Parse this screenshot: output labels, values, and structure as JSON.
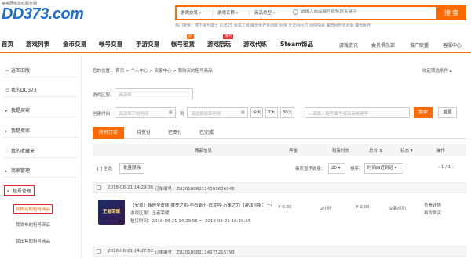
{
  "header": {
    "slogan": "嘟嘟网络游戏服务网",
    "logo": "DD373.com",
    "search": {
      "game_type": "游戏交易",
      "game_name": "游戏名称",
      "product_type": "商品类型",
      "placeholder": "请输入商品编号或标题关键字",
      "button": "搜 索"
    },
    "hot_words": "热门搜索：地下城与勇士  征途2S  浪漫之城  魔兽世界怀旧服  剑侠  天涯明月刀  剑侠情缘  魔兽世界怀旧服  魔兽世界"
  },
  "nav": {
    "items": [
      "首页",
      "游戏列表",
      "金币交易",
      "帐号交易",
      "手游交易",
      "帐号租赁",
      "游戏陪玩",
      "游戏代练",
      "Steam饰品"
    ],
    "badges": {
      "rent": "热",
      "companion": "限时"
    },
    "right": [
      "游戏资讯",
      "会员俱乐部",
      "推广联盟",
      "客服中心"
    ]
  },
  "sidebar": {
    "back": "返回旧版",
    "my_dd373": "我的DD373",
    "buyer": "我是买家",
    "seller": "我是卖家",
    "favorites": "我的收藏夹",
    "merchant": "商家管理",
    "rent_manage": "租号管理",
    "sub_items": [
      "我购买的租号商品",
      "我发布的租号商品",
      "我出售的租号商品"
    ]
  },
  "main": {
    "breadcrumb": [
      "您的位置：",
      "首页",
      "个人中心",
      "买家中心",
      "我购买的租号商品"
    ],
    "collapse": "收起筛选条件",
    "filters": {
      "game_area_label": "游戏区服：",
      "game_area_placeholder": "请选择",
      "created_label": "创建时间：",
      "start_placeholder": "请选择开始时间",
      "to": "到",
      "end_placeholder": "请选择结束时间",
      "quick": [
        "今天",
        "7天",
        "30天"
      ],
      "keyword_placeholder": "请输入租号编号或商品关键字",
      "query": "搜索",
      "reset": "重置"
    },
    "tabs": [
      "所有订单",
      "待支付",
      "已支付",
      "已完成"
    ],
    "columns": [
      "商品信息",
      "押金",
      "租赁时长",
      "总价",
      "状态",
      "操作"
    ],
    "toolbar": {
      "select_all": "全选",
      "batch_delete": "批量删除",
      "per_page": "每页显示数量：",
      "per_page_value": "20",
      "sort_label": "排序：",
      "sort_value": "时间由近到远",
      "pager": "1 / 1"
    },
    "orders": [
      {
        "time": "2018-08-21 14:29:36",
        "order_no": "订单编号：ZU2018082114293626046",
        "title": "【安卓】韩信全皮肤-赛季之影-李白霸王-白龙吟-万象之力【游戏区服：王者荣耀",
        "area": "游戏区服：王者荣耀",
        "rent_time": "租赁时间：2018-08-21 14:29:55 ～ 2018-08-21 16:29:55",
        "deposit": "¥ 0.00",
        "duration": "2小时",
        "total": "¥ 2.00",
        "status": "交易成功",
        "action1": "查看详情",
        "action2": "再次购买",
        "thumb": "王者荣耀"
      },
      {
        "time": "2018-08-21 14:27:52",
        "order_no": "订单编号：ZU2018082114275215793"
      }
    ]
  }
}
